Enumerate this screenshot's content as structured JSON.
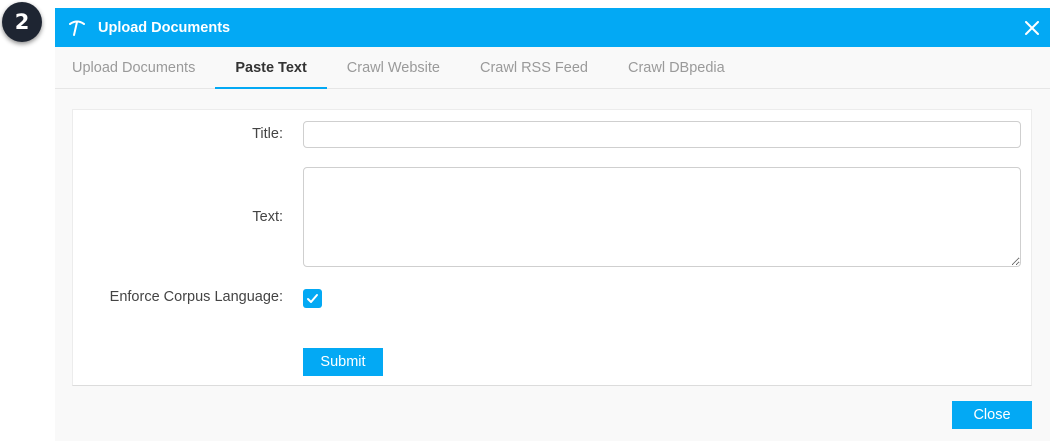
{
  "step_badge": "2",
  "dialog": {
    "title": "Upload Documents",
    "icon": "pickaxe-icon",
    "close_icon": "close-icon",
    "accent_color": "#03a9f4"
  },
  "tabs": [
    {
      "label": "Upload Documents",
      "active": false
    },
    {
      "label": "Paste Text",
      "active": true
    },
    {
      "label": "Crawl Website",
      "active": false
    },
    {
      "label": "Crawl RSS Feed",
      "active": false
    },
    {
      "label": "Crawl DBpedia",
      "active": false
    }
  ],
  "form": {
    "title_label": "Title:",
    "title_value": "",
    "text_label": "Text:",
    "text_value": "",
    "enforce_label": "Enforce Corpus Language:",
    "enforce_checked": true,
    "submit_label": "Submit"
  },
  "footer": {
    "close_label": "Close"
  }
}
